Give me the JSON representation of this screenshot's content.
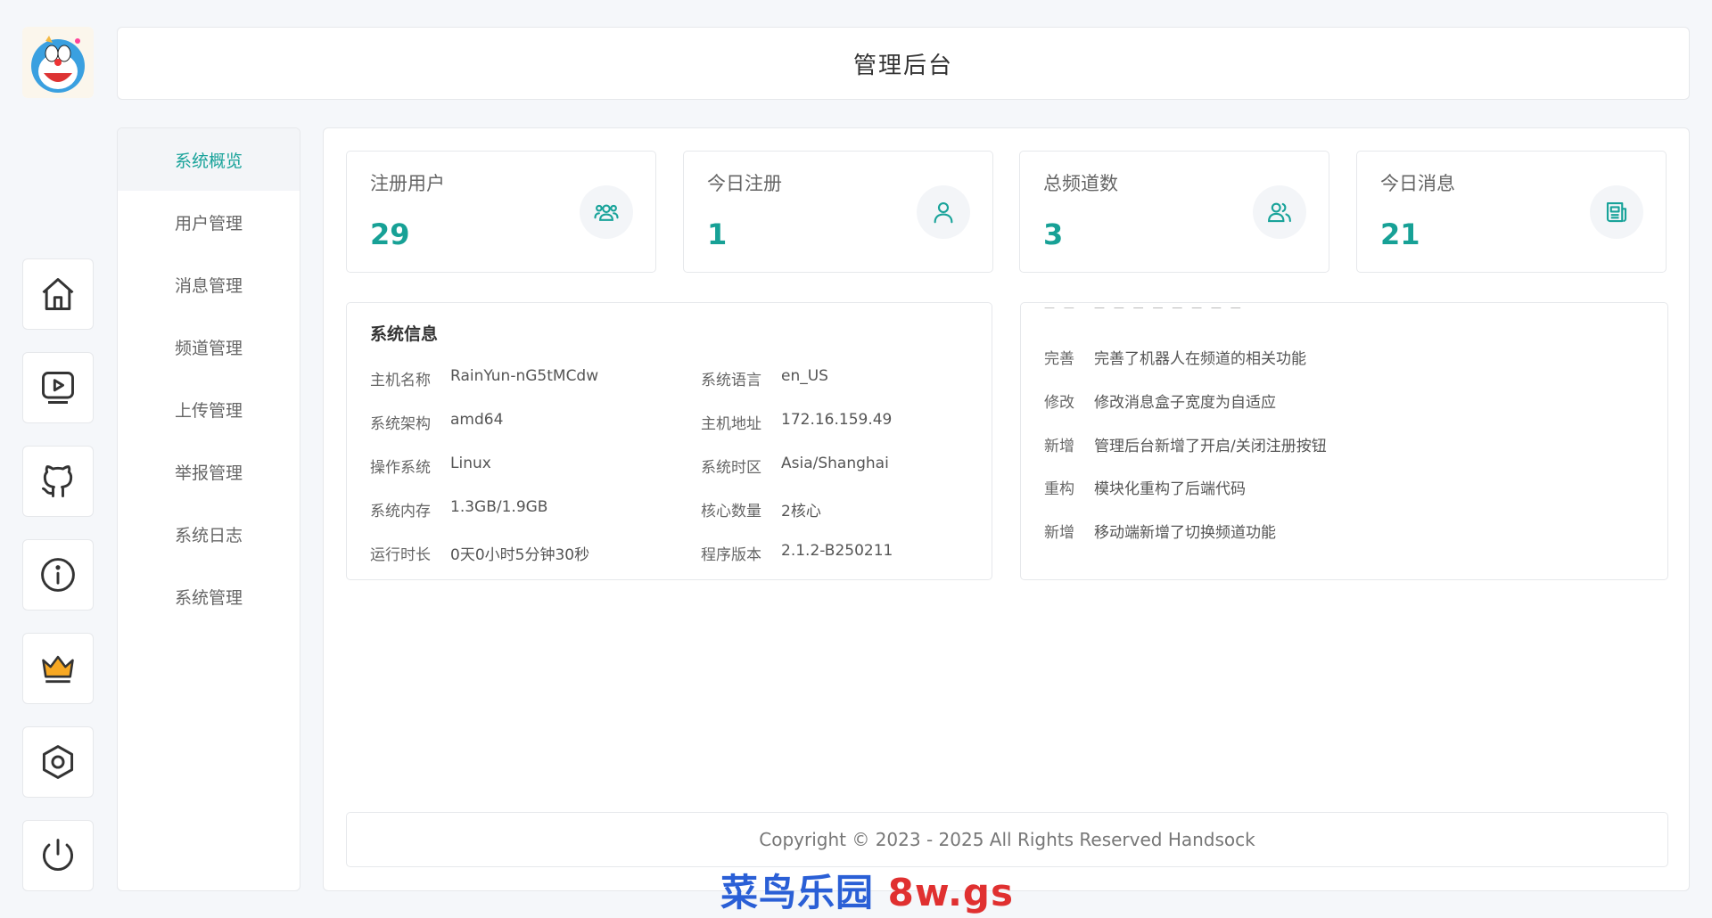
{
  "header": {
    "title": "管理后台"
  },
  "sidebar": {
    "items": [
      {
        "label": "系统概览",
        "active": true
      },
      {
        "label": "用户管理"
      },
      {
        "label": "消息管理"
      },
      {
        "label": "频道管理"
      },
      {
        "label": "上传管理"
      },
      {
        "label": "举报管理"
      },
      {
        "label": "系统日志"
      },
      {
        "label": "系统管理"
      }
    ]
  },
  "iconbar": [
    "home-icon",
    "video-player-icon",
    "github-icon",
    "info-icon",
    "crown-icon",
    "settings-hexagon-icon",
    "power-icon"
  ],
  "stats": [
    {
      "label": "注册用户",
      "value": "29",
      "icon": "users-group-icon"
    },
    {
      "label": "今日注册",
      "value": "1",
      "icon": "user-icon"
    },
    {
      "label": "总频道数",
      "value": "3",
      "icon": "users-pair-icon"
    },
    {
      "label": "今日消息",
      "value": "21",
      "icon": "newspaper-icon"
    }
  ],
  "sysinfo": {
    "title": "系统信息",
    "rows": [
      {
        "k1": "主机名称",
        "v1": "RainYun-nG5tMCdw",
        "k2": "系统语言",
        "v2": "en_US"
      },
      {
        "k1": "系统架构",
        "v1": "amd64",
        "k2": "主机地址",
        "v2": "172.16.159.49"
      },
      {
        "k1": "操作系统",
        "v1": "Linux",
        "k2": "系统时区",
        "v2": "Asia/Shanghai"
      },
      {
        "k1": "系统内存",
        "v1": "1.3GB/1.9GB",
        "k2": "核心数量",
        "v2": "2核心"
      },
      {
        "k1": "运行时长",
        "v1": "0天0小时5分钟30秒",
        "k2": "程序版本",
        "v2": "2.1.2-B250211"
      }
    ]
  },
  "changelog": [
    {
      "type": "完善",
      "desc": "完善了机器人在频道的相关功能"
    },
    {
      "type": "修改",
      "desc": "修改消息盒子宽度为自适应"
    },
    {
      "type": "新增",
      "desc": "管理后台新增了开启/关闭注册按钮"
    },
    {
      "type": "重构",
      "desc": "模块化重构了后端代码"
    },
    {
      "type": "新增",
      "desc": "移动端新增了切换频道功能"
    }
  ],
  "footer": {
    "copyright": "Copyright © 2023 - 2025 All Rights Reserved Handsock"
  },
  "watermark": {
    "text_blue": "菜鸟乐园",
    "text_red": "8w.gs"
  },
  "colors": {
    "accent": "#19a39a",
    "border": "#e6e8eb",
    "background": "#f5f7fa"
  }
}
